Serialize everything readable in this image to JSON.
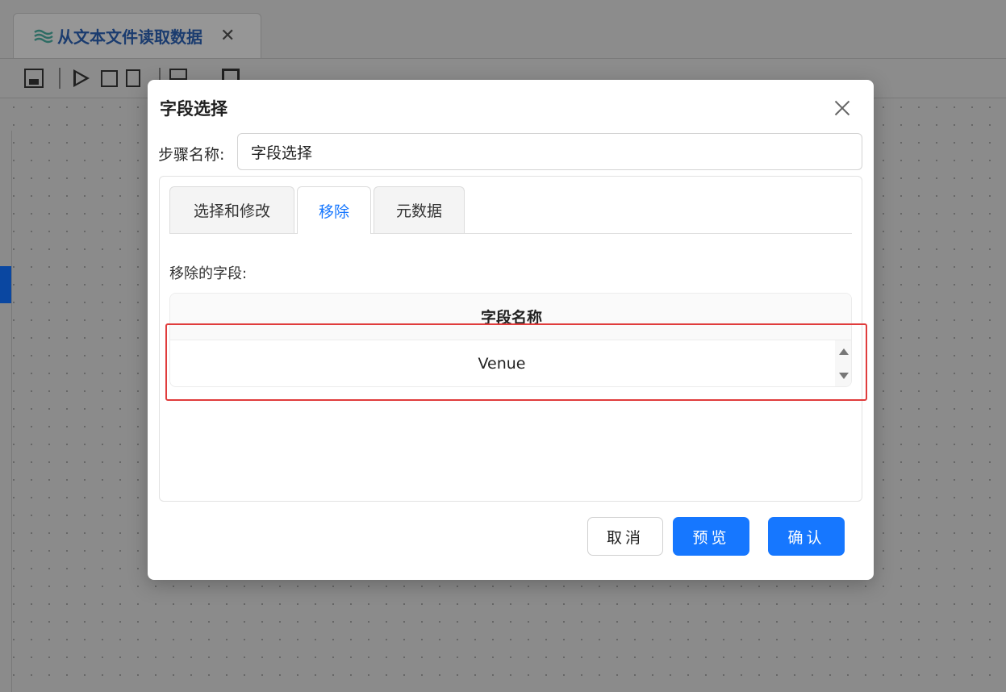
{
  "background_app": {
    "file_tab": {
      "title": "从文本文件读取数据",
      "icon": "layers-icon",
      "close_icon": "✕"
    },
    "toolbar_icons": [
      "save-icon",
      "run-icon",
      "stop-icon",
      "step-icon",
      "grid-icon",
      "layout-icon",
      "undo-icon",
      "redo-icon",
      "unlock-icon",
      "cloud-icon"
    ]
  },
  "dialog": {
    "title": "字段选择",
    "close_icon": "close-icon",
    "step_name_label": "步骤名称:",
    "step_name_value": "字段选择",
    "tabs": [
      {
        "label": "选择和修改",
        "active": false
      },
      {
        "label": "移除",
        "active": true
      },
      {
        "label": "元数据",
        "active": false
      }
    ],
    "removed_fields_label": "移除的字段:",
    "table": {
      "header": "字段名称",
      "rows": [
        "Venue"
      ]
    },
    "buttons": {
      "cancel": "取消",
      "preview": "预览",
      "confirm": "确认"
    }
  },
  "colors": {
    "primary": "#1677ff",
    "highlight_border": "#e03c3c",
    "active_tab_text": "#1677ff"
  }
}
